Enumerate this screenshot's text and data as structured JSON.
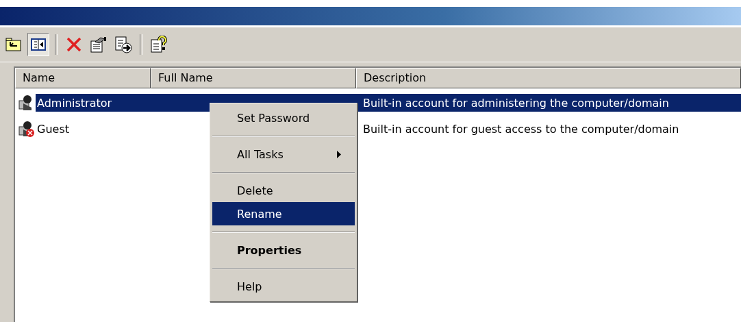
{
  "toolbar": [
    {
      "kind": "up",
      "pressed": false
    },
    {
      "kind": "pane",
      "pressed": true
    },
    {
      "kind": "delete",
      "pressed": false
    },
    {
      "kind": "properties",
      "pressed": false
    },
    {
      "kind": "export",
      "pressed": false
    },
    {
      "kind": "help",
      "pressed": false
    }
  ],
  "table": {
    "columns": [
      "Name",
      "Full Name",
      "Description"
    ],
    "rows": [
      {
        "name": "Administrator",
        "full_name": "",
        "description": "Built-in account for administering the computer/domain",
        "selected": true,
        "disabled": false
      },
      {
        "name": "Guest",
        "full_name": "",
        "description": "Built-in account for guest access to the computer/domain",
        "selected": false,
        "disabled": true
      }
    ]
  },
  "context_menu": [
    {
      "kind": "item",
      "label": "Set Password",
      "submenu": false,
      "default": false,
      "selected": false
    },
    {
      "kind": "separator"
    },
    {
      "kind": "item",
      "label": "All Tasks",
      "submenu": true,
      "default": false,
      "selected": false
    },
    {
      "kind": "separator"
    },
    {
      "kind": "item",
      "label": "Delete",
      "submenu": false,
      "default": false,
      "selected": false
    },
    {
      "kind": "item",
      "label": "Rename",
      "submenu": false,
      "default": false,
      "selected": true
    },
    {
      "kind": "separator"
    },
    {
      "kind": "item",
      "label": "Properties",
      "submenu": false,
      "default": true,
      "selected": false
    },
    {
      "kind": "separator"
    },
    {
      "kind": "item",
      "label": "Help",
      "submenu": false,
      "default": false,
      "selected": false
    }
  ]
}
